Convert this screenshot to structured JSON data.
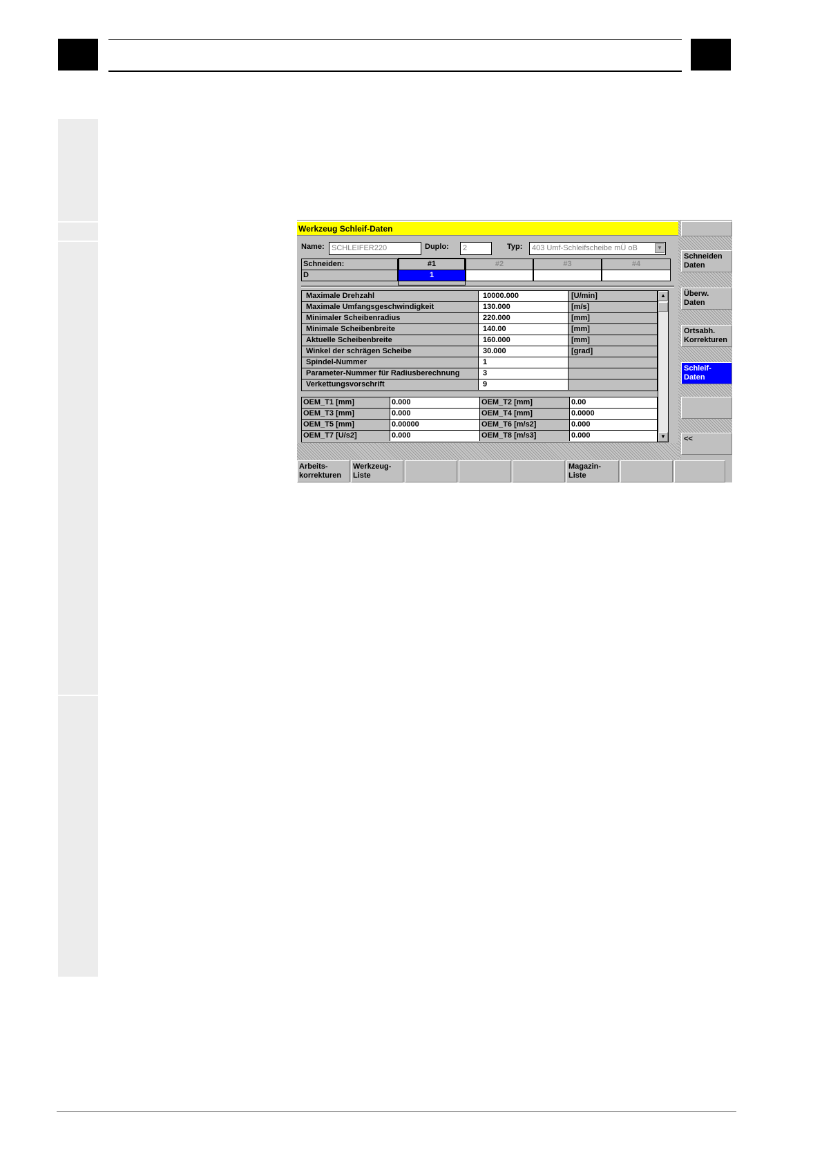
{
  "window": {
    "title": "Werkzeug  Schleif-Daten"
  },
  "header": {
    "name_label": "Name:",
    "name_value": "SCHLEIFER220",
    "duplo_label": "Duplo:",
    "duplo_value": "2",
    "typ_label": "Typ:",
    "typ_value": "403 Umf-Schleifscheibe mÜ oB"
  },
  "cutting_edges": {
    "row_label": "Schneiden:",
    "d_label": "D",
    "columns": [
      "#1",
      "#2",
      "#3",
      "#4"
    ],
    "d_values": [
      "1",
      "",
      "",
      ""
    ],
    "selected_index": 0
  },
  "parameters": [
    {
      "name": "Maximale Drehzahl",
      "value": "10000.000",
      "unit": "[U/min]"
    },
    {
      "name": "Maximale Umfangsgeschwindigkeit",
      "value": "130.000",
      "unit": "[m/s]"
    },
    {
      "name": "Minimaler  Scheibenradius",
      "value": "220.000",
      "unit": "[mm]"
    },
    {
      "name": "Minimale Scheibenbreite",
      "value": "140.00",
      "unit": "[mm]"
    },
    {
      "name": "Aktuelle Scheibenbreite",
      "value": "160.000",
      "unit": "[mm]"
    },
    {
      "name": "Winkel der schrägen Scheibe",
      "value": "30.000",
      "unit": "[grad]"
    },
    {
      "name": "Spindel-Nummer",
      "value": "1",
      "unit": ""
    },
    {
      "name": "Parameter-Nummer für Radiusberechnung",
      "value": "3",
      "unit": ""
    },
    {
      "name": "Verkettungsvorschrift",
      "value": "9",
      "unit": ""
    }
  ],
  "oem": [
    {
      "l_label": "OEM_T1 [mm]",
      "l_value": "0.000",
      "r_label": "OEM_T2 [mm]",
      "r_value": "0.00"
    },
    {
      "l_label": "OEM_T3 [mm]",
      "l_value": "0.000",
      "r_label": "OEM_T4 [mm]",
      "r_value": "0.0000"
    },
    {
      "l_label": "OEM_T5 [mm]",
      "l_value": "0.00000",
      "r_label": "OEM_T6 [m/s2]",
      "r_value": "0.000"
    },
    {
      "l_label": "OEM_T7 [U/s2]",
      "l_value": "0.000",
      "r_label": "OEM_T8 [m/s3]",
      "r_value": "0.000"
    }
  ],
  "vertical_softkeys": [
    "",
    "Schneiden\nDaten",
    "Überw.\nDaten",
    "Ortsabh.\nKorrekturen",
    "Schleif-\nDaten",
    "",
    "<<"
  ],
  "horizontal_softkeys": [
    "Arbeits-\nkorrekturen",
    "Werkzeug-\nListe",
    "",
    "",
    "",
    "Magazin-\nListe",
    "",
    ""
  ],
  "colors": {
    "title_bar": "#ffff00",
    "selection": "#0000ff",
    "panel": "#c0c0c0"
  },
  "icons": {
    "dropdown": "chevron-down-icon",
    "scroll_up": "arrow-up-icon",
    "scroll_down": "arrow-down-icon"
  }
}
